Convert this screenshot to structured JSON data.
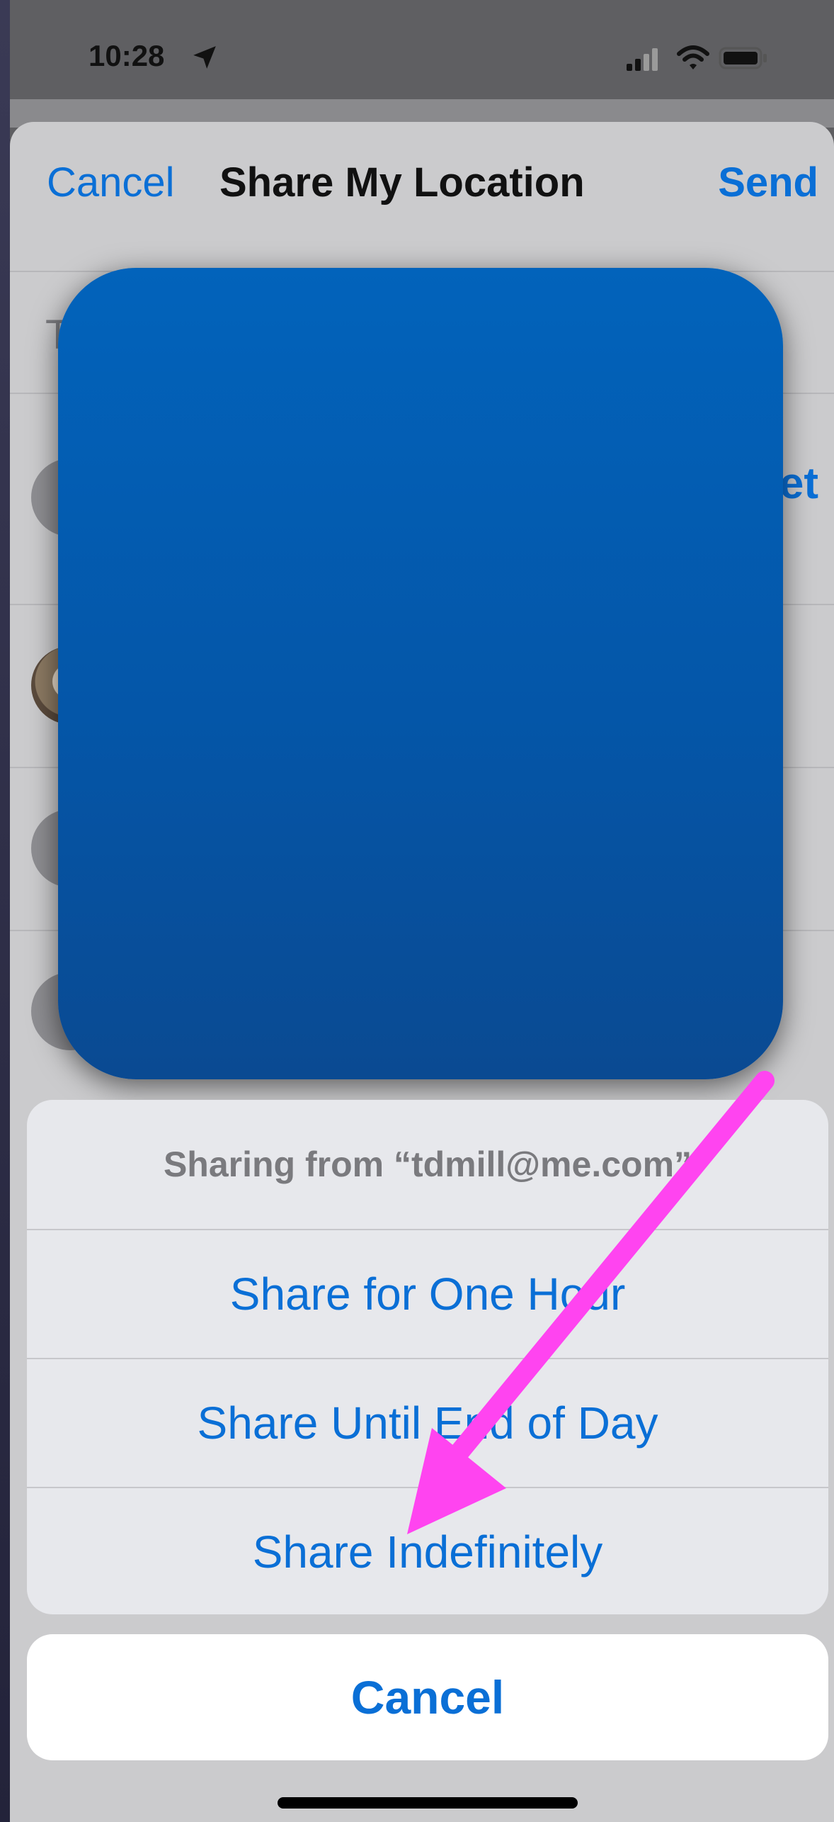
{
  "status_bar": {
    "time": "10:28"
  },
  "nav": {
    "cancel_label": "Cancel",
    "title": "Share My Location",
    "send_label": "Send"
  },
  "to_field": {
    "label": "T"
  },
  "rows": [
    {
      "trailing_fragment": "et"
    },
    {},
    {},
    {}
  ],
  "action_sheet": {
    "header": "Sharing from “tdmill@me.com”",
    "options": [
      "Share for One Hour",
      "Share Until End of Day",
      "Share Indefinitely"
    ],
    "cancel_label": "Cancel"
  },
  "colors": {
    "accent": "#0a6fd6",
    "annotation_arrow": "#ff44f0",
    "redaction_box": "#0456a8"
  }
}
